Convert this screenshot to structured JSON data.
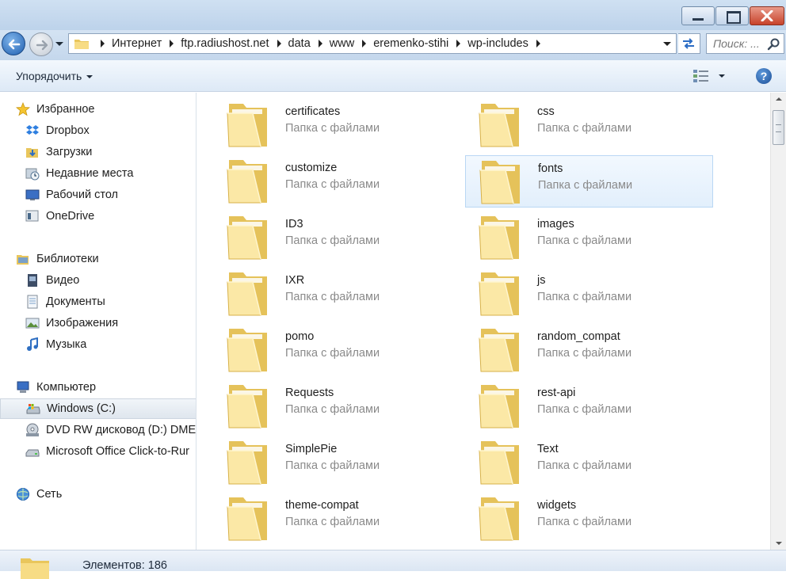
{
  "window": {
    "controls": {
      "minimize_icon": "minimize-icon",
      "maximize_icon": "maximize-icon",
      "close_icon": "close-icon"
    }
  },
  "address_bar": {
    "crumbs": [
      "Интернет",
      "ftp.radiushost.net",
      "data",
      "www",
      "eremenko-stihi",
      "wp-includes"
    ],
    "search_placeholder": "Поиск: ..."
  },
  "toolbar": {
    "organize_label": "Упорядочить",
    "help_label": "?"
  },
  "sidebar": {
    "items": [
      {
        "label": "Избранное",
        "icon": "star-icon"
      },
      {
        "label": "Dropbox",
        "icon": "dropbox-icon"
      },
      {
        "label": "Загрузки",
        "icon": "downloads-icon"
      },
      {
        "label": "Недавние места",
        "icon": "recent-places-icon"
      },
      {
        "label": "Рабочий стол",
        "icon": "desktop-icon"
      },
      {
        "label": "OneDrive",
        "icon": "onedrive-icon"
      },
      {
        "label": "Библиотеки",
        "icon": "libraries-icon"
      },
      {
        "label": "Видео",
        "icon": "video-icon"
      },
      {
        "label": "Документы",
        "icon": "documents-icon"
      },
      {
        "label": "Изображения",
        "icon": "pictures-icon"
      },
      {
        "label": "Музыка",
        "icon": "music-icon"
      },
      {
        "label": "Компьютер",
        "icon": "computer-icon"
      },
      {
        "label": "Windows (C:)",
        "icon": "drive-icon",
        "selected": true
      },
      {
        "label": "DVD RW дисковод (D:) DME",
        "icon": "dvd-drive-icon"
      },
      {
        "label": "Microsoft Office Click-to-Rur",
        "icon": "office-drive-icon"
      },
      {
        "label": "Сеть",
        "icon": "network-icon"
      }
    ]
  },
  "folders": {
    "type_label": "Папка с файлами",
    "items": [
      "certificates",
      "css",
      "customize",
      "fonts",
      "ID3",
      "images",
      "IXR",
      "js",
      "pomo",
      "random_compat",
      "Requests",
      "rest-api",
      "SimplePie",
      "Text",
      "theme-compat",
      "widgets"
    ],
    "selected": "fonts"
  },
  "status": {
    "count_text": "Элементов: 186"
  },
  "colors": {
    "folder_light": "#fbe8a6",
    "folder_dark": "#e5c25a",
    "selection_bg": "#e6f1fc",
    "selection_border": "#b9d7f4",
    "accent_blue": "#1f5fb0"
  }
}
